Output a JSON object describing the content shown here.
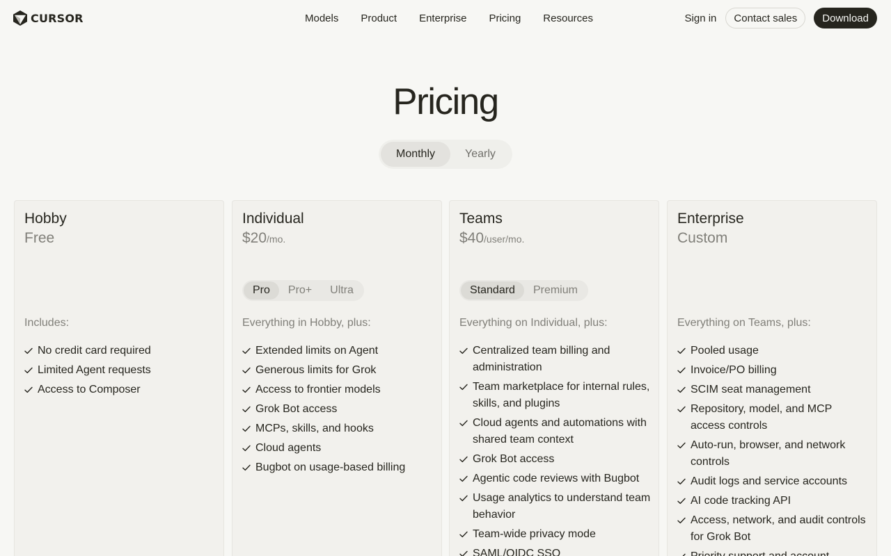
{
  "nav": {
    "logo_text": "CURSOR",
    "links": [
      "Models",
      "Product",
      "Enterprise",
      "Pricing",
      "Resources"
    ],
    "sign_in": "Sign in",
    "contact_sales": "Contact sales",
    "download": "Download"
  },
  "page": {
    "title": "Pricing",
    "billing_toggle": {
      "options": [
        "Monthly",
        "Yearly"
      ],
      "selected": "Monthly"
    }
  },
  "plans": [
    {
      "name": "Hobby",
      "price": "Free",
      "unit": "",
      "includes": "Includes:",
      "features": [
        "No credit card required",
        "Limited Agent requests",
        "Access to Composer"
      ]
    },
    {
      "name": "Individual",
      "price": "$20",
      "unit": "/mo.",
      "tiers": [
        "Pro",
        "Pro+",
        "Ultra"
      ],
      "selected_tier": "Pro",
      "includes": "Everything in Hobby, plus:",
      "features": [
        "Extended limits on Agent",
        "Generous limits for Grok",
        "Access to frontier models",
        "Grok Bot access",
        "MCPs, skills, and hooks",
        "Cloud agents",
        "Bugbot on usage-based billing"
      ]
    },
    {
      "name": "Teams",
      "price": "$40",
      "unit": "/user/mo.",
      "tiers": [
        "Standard",
        "Premium"
      ],
      "selected_tier": "Standard",
      "includes": "Everything on Individual, plus:",
      "features": [
        "Centralized team billing and administration",
        "Team marketplace for internal rules, skills, and plugins",
        "Cloud agents and automations with shared team context",
        "Grok Bot access",
        "Agentic code reviews with Bugbot",
        "Usage analytics to understand team behavior",
        "Team-wide privacy mode",
        "SAML/OIDC SSO"
      ]
    },
    {
      "name": "Enterprise",
      "price": "Custom",
      "unit": "",
      "includes": "Everything on Teams, plus:",
      "features": [
        "Pooled usage",
        "Invoice/PO billing",
        "SCIM seat management",
        "Repository, model, and MCP access controls",
        "Auto-run, browser, and network controls",
        "Audit logs and service accounts",
        "AI code tracking API",
        "Access, network, and audit controls for Grok Bot",
        "Priority support and account"
      ]
    }
  ]
}
